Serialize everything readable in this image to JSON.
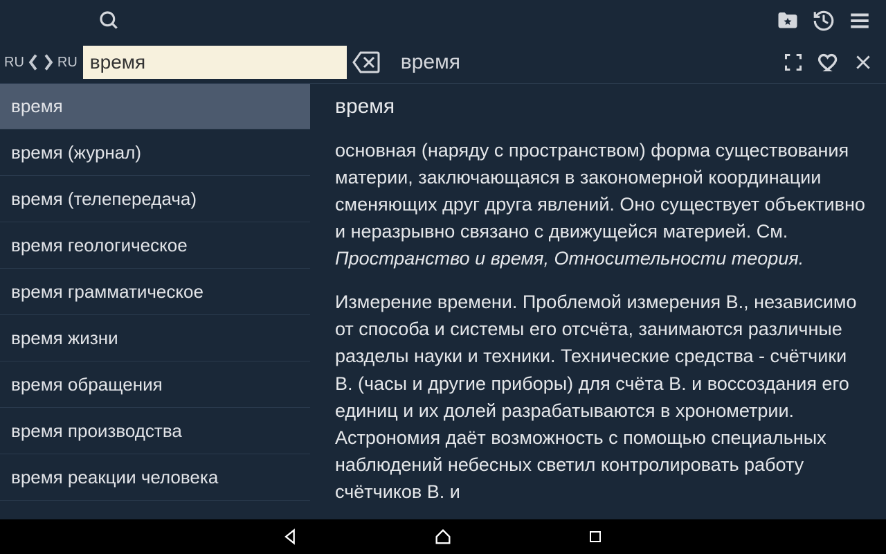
{
  "lang": {
    "from": "RU",
    "to": "RU"
  },
  "search": {
    "value": "время"
  },
  "headword": "время",
  "sidebar": {
    "items": [
      {
        "label": "время",
        "selected": true
      },
      {
        "label": "время (журнал)",
        "selected": false
      },
      {
        "label": "время (телепередача)",
        "selected": false
      },
      {
        "label": "время геологическое",
        "selected": false
      },
      {
        "label": "время грамматическое",
        "selected": false
      },
      {
        "label": "время жизни",
        "selected": false
      },
      {
        "label": "время обращения",
        "selected": false
      },
      {
        "label": "время производства",
        "selected": false
      },
      {
        "label": "время реакции человека",
        "selected": false
      }
    ]
  },
  "article": {
    "title": "время",
    "p1_a": "основная (наряду с пространством) форма существования материи, заключающаяся в закономерной координации сменяющих друг друга явлений. Оно существует объективно и неразрывно связано с движущейся материей. См. ",
    "p1_i": "Пространство и время, Относительности теория.",
    "p2": "Измерение времени. Проблемой измерения В., независимо от способа и системы его отсчёта, занимаются различные разделы науки и техники. Технические средства - счётчики В. (часы и другие приборы) для счёта В. и воссоздания его единиц и их долей разрабатываются в хронометрии. Астрономия даёт возможность с помощью специальных наблюдений небесных светил контролировать работу счётчиков В. и"
  }
}
